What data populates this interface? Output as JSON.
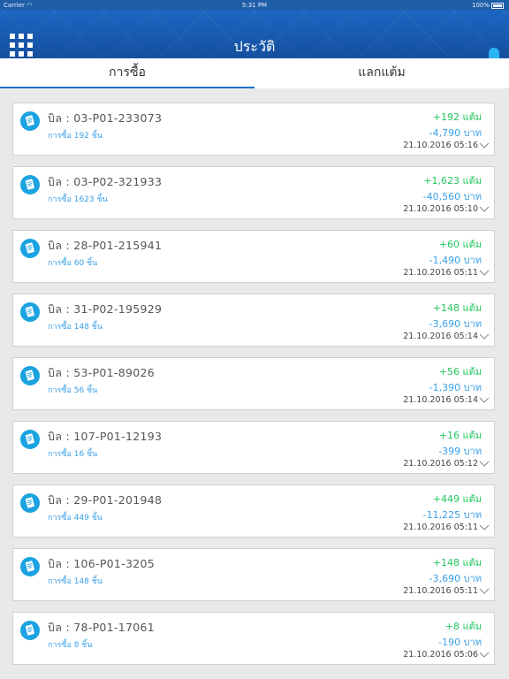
{
  "status": {
    "carrier": "Carrier",
    "time": "5:31 PM",
    "battery": "100%"
  },
  "header": {
    "title": "ประวัติ"
  },
  "tabs": [
    {
      "label": "การซื้อ"
    },
    {
      "label": "แลกแต้ม"
    }
  ],
  "records": [
    {
      "bill": "บิล : 03-P01-233073",
      "qty": "การซื้อ 192 ชิ้น",
      "points": "+192 แต้ม",
      "baht": "-4,790 บาท",
      "date": "21.10.2016 05:16"
    },
    {
      "bill": "บิล : 03-P02-321933",
      "qty": "การซื้อ 1623 ชิ้น",
      "points": "+1,623 แต้ม",
      "baht": "-40,560 บาท",
      "date": "21.10.2016 05:10"
    },
    {
      "bill": "บิล : 28-P01-215941",
      "qty": "การซื้อ 60 ชิ้น",
      "points": "+60 แต้ม",
      "baht": "-1,490 บาท",
      "date": "21.10.2016 05:11"
    },
    {
      "bill": "บิล : 31-P02-195929",
      "qty": "การซื้อ 148 ชิ้น",
      "points": "+148 แต้ม",
      "baht": "-3,690 บาท",
      "date": "21.10.2016 05:14"
    },
    {
      "bill": "บิล : 53-P01-89026",
      "qty": "การซื้อ 56 ชิ้น",
      "points": "+56 แต้ม",
      "baht": "-1,390 บาท",
      "date": "21.10.2016 05:14"
    },
    {
      "bill": "บิล : 107-P01-12193",
      "qty": "การซื้อ 16 ชิ้น",
      "points": "+16 แต้ม",
      "baht": "-399 บาท",
      "date": "21.10.2016 05:12"
    },
    {
      "bill": "บิล : 29-P01-201948",
      "qty": "การซื้อ 449 ชิ้น",
      "points": "+449 แต้ม",
      "baht": "-11,225 บาท",
      "date": "21.10.2016 05:11"
    },
    {
      "bill": "บิล : 106-P01-3205",
      "qty": "การซื้อ 148 ชิ้น",
      "points": "+148 แต้ม",
      "baht": "-3,690 บาท",
      "date": "21.10.2016 05:11"
    },
    {
      "bill": "บิล : 78-P01-17061",
      "qty": "การซื้อ 8 ชิ้น",
      "points": "+8 แต้ม",
      "baht": "-190 บาท",
      "date": "21.10.2016 05:06"
    }
  ],
  "colors": {
    "header": "#1a5db3",
    "points": "#22c55e",
    "baht": "#3aa0e6",
    "tab_underline": "#1a6fd1",
    "icon": "#1aa3e0"
  },
  "icons": {
    "menu": "grid-menu-icon",
    "notify": "bell-icon",
    "record": "receipt-icon",
    "expand": "chevron-down-icon"
  }
}
